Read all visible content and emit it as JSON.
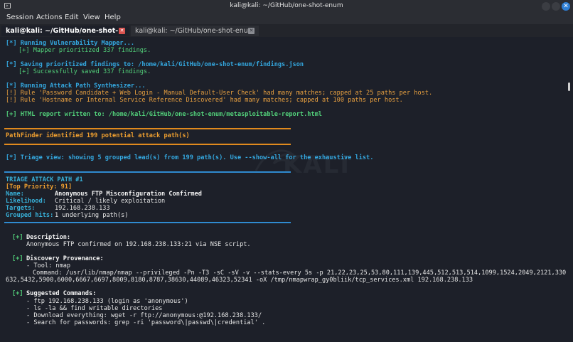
{
  "window": {
    "title": "kali@kali: ~/GitHub/one-shot-enum",
    "icon": "terminal-icon",
    "accent": "#2e7fd6"
  },
  "menu": [
    "Session",
    "Actions",
    "Edit",
    "View",
    "Help"
  ],
  "tabs": [
    {
      "label": "kali@kali: ~/GitHub/one-shot-enum",
      "active": true
    },
    {
      "label": "kali@kali: ~/GitHub/one-shot-enum",
      "active": false
    }
  ],
  "terminal": {
    "vuln_mapper": "[*] Running Vulnerability Mapper...",
    "vuln_mapper_result": "[+] Mapper prioritized 337 findings.",
    "saving": "[*] Saving prioritized findings to: /home/kali/GitHub/one-shot-enum/findings.json",
    "saving_result": "[+] Successfully saved 337 findings.",
    "synth": "[*] Running Attack Path Synthesizer...",
    "warn1": "[!] Rule 'Password Candidate + Web Login - Manual Default-User Check' had many matches; capped at 25 paths per host.",
    "warn2": "[!] Rule 'Hostname or Internal Service Reference Discovered' had many matches; capped at 100 paths per host.",
    "html_report": "[+] HTML report written to: /home/kali/GitHub/one-shot-enum/metasploitable-report.html",
    "pathfinder": "PathFinder identified 199 potential attack path(s)",
    "triage_view": "[*] Triage view: showing 5 grouped lead(s) from 199 path(s). Use --show-all for the exhaustive list.",
    "triage_header": "TRIAGE ATTACK PATH #1",
    "priority": "[Top Priority: 91]",
    "name_label": "Name:",
    "name_value": "Anonymous FTP Misconfiguration Confirmed",
    "likelihood_label": "Likelihood:",
    "likelihood_value": "Critical / likely exploitation",
    "targets_label": "Targets:",
    "targets_value": "192.168.238.133",
    "grouped_label": "Grouped hits:",
    "grouped_value": "1 underlying path(s)",
    "desc_marker": "[+]",
    "desc_title": "Description:",
    "desc_text": "Anonymous FTP confirmed on 192.168.238.133:21 via NSE script.",
    "prov_marker": "[+]",
    "prov_title": "Discovery Provenance:",
    "prov_tool": "- Tool: nmap",
    "prov_cmd1": "Command: /usr/lib/nmap/nmap --privileged -Pn -T3 -sC -sV -v --stats-every 5s -p 21,22,23,25,53,80,111,139,445,512,513,514,1099,1524,2049,2121,3306,3",
    "prov_cmd2": "632,5432,5900,6000,6667,6697,8009,8180,8787,38630,44089,46323,52341 -oX /tmp/nmapwrap_gy0bliik/tcp_services.xml 192.168.238.133",
    "cmd_marker": "[+]",
    "cmd_title": "Suggested Commands:",
    "cmd1": "- ftp 192.168.238.133 (login as 'anonymous')",
    "cmd2": "- ls -la && find writable directories",
    "cmd3": "- Download everything: wget -r ftp://anonymous:@192.168.238.133/",
    "cmd4": "- Search for passwords: grep -ri 'password\\|passwd\\|credential' ."
  },
  "watermark": "KALI"
}
